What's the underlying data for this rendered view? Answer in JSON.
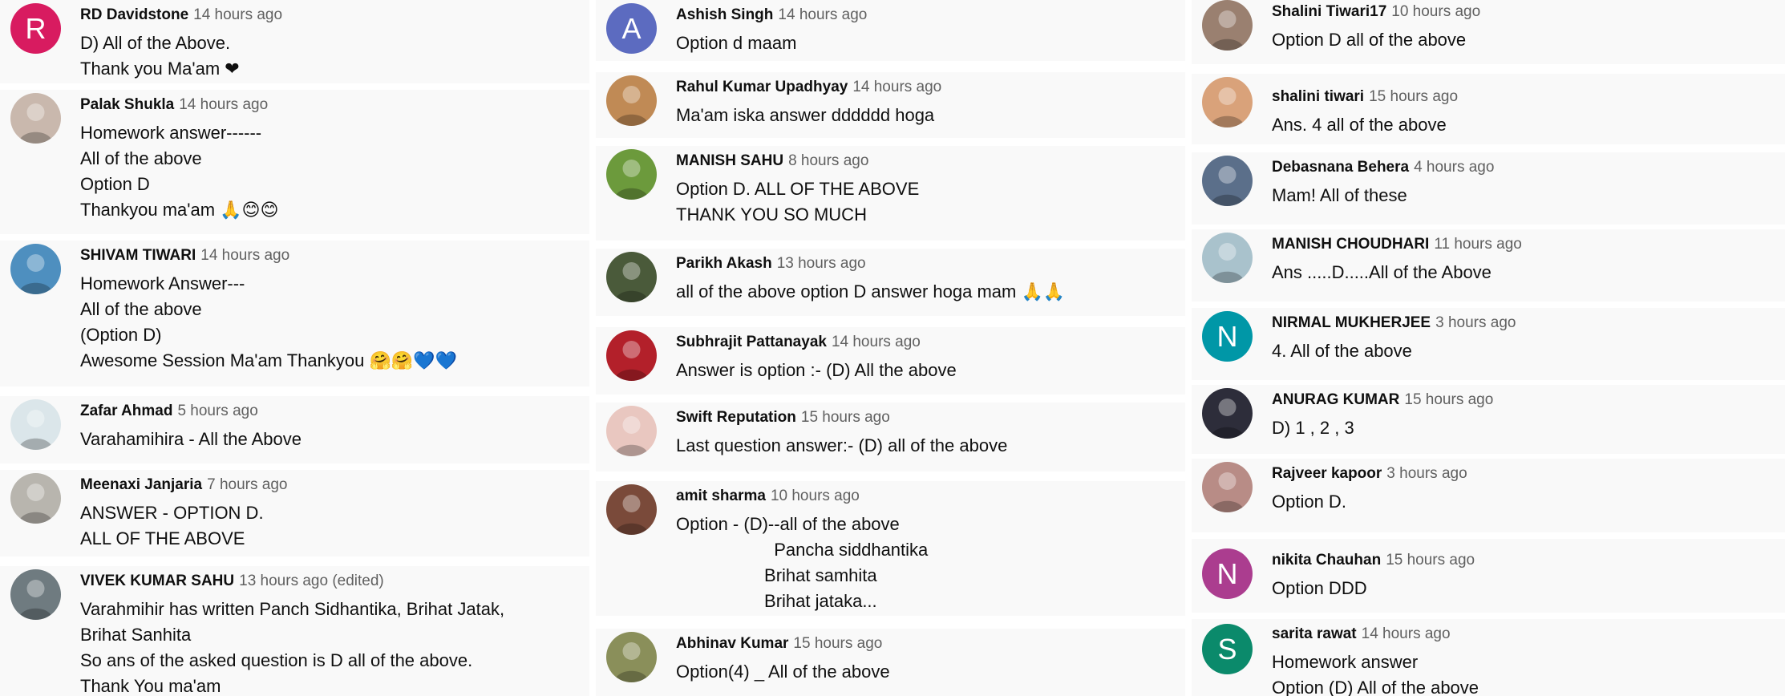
{
  "columns": [
    {
      "comments": [
        {
          "author": "RD Davidstone",
          "time": "14 hours ago",
          "avatar_letter": "R",
          "avatar_color": "#d81b60",
          "lines": [
            "D) All of the Above.",
            "Thank you Ma'am ❤"
          ]
        },
        {
          "author": "Palak Shukla",
          "time": "14 hours ago",
          "avatar_letter": "",
          "avatar_color": "#c9b8ad",
          "lines": [
            "Homework answer------",
            "All of the above",
            "Option D",
            "Thankyou ma'am 🙏😊😊"
          ]
        },
        {
          "author": "SHIVAM TIWARI",
          "time": "14 hours ago",
          "avatar_letter": "",
          "avatar_color": "#4e8fbf",
          "lines": [
            "Homework Answer---",
            "All of the above",
            "(Option D)",
            "Awesome Session Ma'am Thankyou 🤗🤗💙💙"
          ]
        },
        {
          "author": "Zafar Ahmad",
          "time": "5 hours ago",
          "avatar_letter": "",
          "avatar_color": "#dbe6ea",
          "lines": [
            "Varahamihira - All the Above"
          ]
        },
        {
          "author": "Meenaxi Janjaria",
          "time": "7 hours ago",
          "avatar_letter": "",
          "avatar_color": "#b8b5ae",
          "lines": [
            "ANSWER - OPTION D.",
            "ALL OF THE ABOVE"
          ]
        },
        {
          "author": "VIVEK KUMAR SAHU",
          "time": "13 hours ago (edited)",
          "avatar_letter": "",
          "avatar_color": "#6f7b80",
          "lines": [
            "Varahmihir has written Panch Sidhantika, Brihat Jatak,",
            "Brihat Sanhita",
            "So ans of the asked question is D all of the above.",
            "Thank You ma'am"
          ]
        }
      ]
    },
    {
      "comments": [
        {
          "author": "Ashish Singh",
          "time": "14 hours ago",
          "avatar_letter": "A",
          "avatar_color": "#5c6bc0",
          "lines": [
            "Option d maam"
          ]
        },
        {
          "author": "Rahul Kumar Upadhyay",
          "time": "14 hours ago",
          "avatar_letter": "",
          "avatar_color": "#c08a55",
          "lines": [
            "Ma'am iska answer dddddd hoga"
          ]
        },
        {
          "author": "MANISH SAHU",
          "time": "8 hours ago",
          "avatar_letter": "",
          "avatar_color": "#6c9a3c",
          "lines": [
            "Option D. ALL OF THE ABOVE",
            "THANK YOU SO MUCH"
          ]
        },
        {
          "author": "Parikh Akash",
          "time": "13 hours ago",
          "avatar_letter": "",
          "avatar_color": "#4a5a3a",
          "lines": [
            "all of the above option D answer hoga mam 🙏🙏"
          ]
        },
        {
          "author": "Subhrajit Pattanayak",
          "time": "14 hours ago",
          "avatar_letter": "",
          "avatar_color": "#b3202a",
          "lines": [
            "Answer is option :- (D) All the above"
          ]
        },
        {
          "author": "Swift Reputation",
          "time": "15 hours ago",
          "avatar_letter": "",
          "avatar_color": "#e9c7c0",
          "lines": [
            "Last question answer:- (D) all of the above"
          ]
        },
        {
          "author": "amit sharma",
          "time": "10 hours ago",
          "avatar_letter": "",
          "avatar_color": "#7a4a3a",
          "lines": [
            "Option - (D)--all of the above",
            "                    Pancha siddhantika",
            "                  Brihat samhita",
            "                  Brihat jataka..."
          ]
        },
        {
          "author": "Abhinav Kumar",
          "time": "15 hours ago",
          "avatar_letter": "",
          "avatar_color": "#8a8f5a",
          "lines": [
            "Option(4) _ All of the above"
          ]
        }
      ]
    },
    {
      "comments": [
        {
          "author": "Shalini Tiwari17",
          "time": "10 hours ago",
          "avatar_letter": "",
          "avatar_color": "#9a8070",
          "lines": [
            "Option D all of the above"
          ]
        },
        {
          "author": "shalini tiwari",
          "time": "15 hours ago",
          "avatar_letter": "",
          "avatar_color": "#d9a27a",
          "lines": [
            "Ans. 4 all of the above"
          ]
        },
        {
          "author": "Debasnana Behera",
          "time": "4 hours ago",
          "avatar_letter": "",
          "avatar_color": "#5b6f8a",
          "lines": [
            "Mam! All of these"
          ]
        },
        {
          "author": "MANISH CHOUDHARI",
          "time": "11 hours ago",
          "avatar_letter": "",
          "avatar_color": "#a9c2cc",
          "lines": [
            "Ans .....D.....All of the Above"
          ]
        },
        {
          "author": "NIRMAL MUKHERJEE",
          "time": "3 hours ago",
          "avatar_letter": "N",
          "avatar_color": "#0097a7",
          "lines": [
            "4. All of the above"
          ]
        },
        {
          "author": "ANURAG KUMAR",
          "time": "15 hours ago",
          "avatar_letter": "",
          "avatar_color": "#2d2d3a",
          "lines": [
            "D) 1 , 2 , 3"
          ]
        },
        {
          "author": "Rajveer kapoor",
          "time": "3 hours ago",
          "avatar_letter": "",
          "avatar_color": "#b88c86",
          "lines": [
            "Option D."
          ]
        },
        {
          "author": "nikita Chauhan",
          "time": "15 hours ago",
          "avatar_letter": "N",
          "avatar_color": "#ab3d8f",
          "lines": [
            "Option DDD"
          ]
        },
        {
          "author": "sarita rawat",
          "time": "14 hours ago",
          "avatar_letter": "S",
          "avatar_color": "#0b8a6b",
          "lines": [
            "Homework answer",
            "Option (D) All of the above"
          ]
        }
      ]
    }
  ]
}
